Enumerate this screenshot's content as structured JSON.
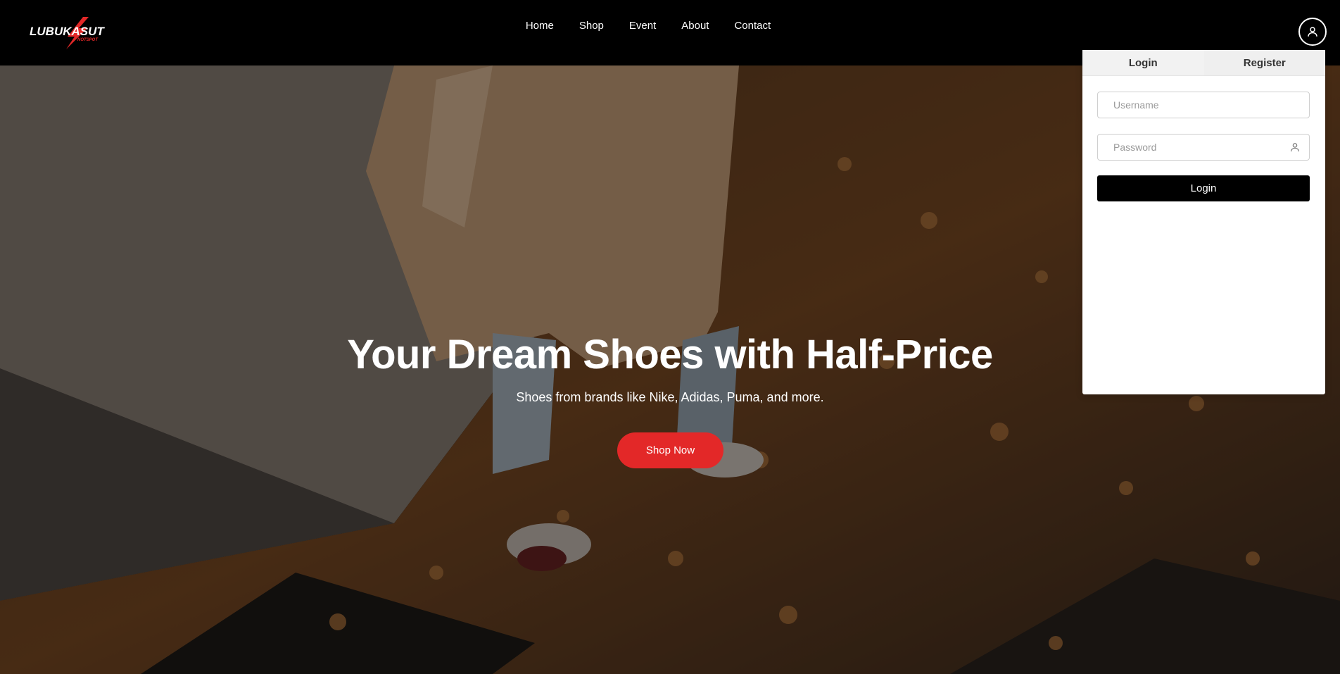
{
  "brand": {
    "logo_main": "LUBUKASUT",
    "logo_sub": "NOTSPOT"
  },
  "nav": {
    "items": [
      {
        "label": "Home"
      },
      {
        "label": "Shop"
      },
      {
        "label": "Event"
      },
      {
        "label": "About"
      },
      {
        "label": "Contact"
      }
    ],
    "profile_icon": "user-icon"
  },
  "hero": {
    "title": "Your Dream Shoes with Half-Price",
    "subtitle": "Shoes from brands like Nike, Adidas, Puma, and more.",
    "cta_label": "Shop Now",
    "cta_color": "#e32828"
  },
  "auth": {
    "tabs": [
      {
        "label": "Login",
        "active": true
      },
      {
        "label": "Register",
        "active": false
      }
    ],
    "username_placeholder": "Username",
    "password_placeholder": "Password",
    "password_icon": "user-icon",
    "submit_label": "Login"
  }
}
